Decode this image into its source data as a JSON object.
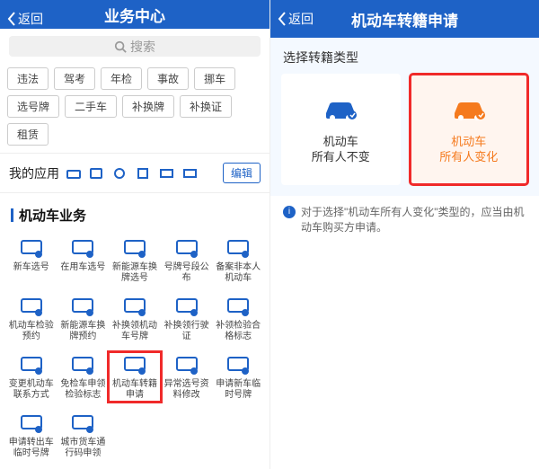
{
  "left": {
    "back": "返回",
    "title": "业务中心",
    "search_placeholder": "搜索",
    "chips": [
      "违法",
      "驾考",
      "年检",
      "事故",
      "挪车",
      "选号牌",
      "二手车",
      "补换牌",
      "补换证",
      "租赁"
    ],
    "myapps_label": "我的应用",
    "edit_label": "编辑",
    "section_title": "机动车业务",
    "grid": [
      "新车选号",
      "在用车选号",
      "新能源车换牌选号",
      "号牌号段公布",
      "备案非本人机动车",
      "机动车检验预约",
      "新能源车换牌预约",
      "补换领机动车号牌",
      "补换领行驶证",
      "补领检验合格标志",
      "变更机动车联系方式",
      "免检车申领检验标志",
      "机动车转籍申请",
      "异常选号资料修改",
      "申请新车临时号牌",
      "申请转出车临时号牌",
      "城市货车通行码申领"
    ],
    "highlight_index": 12
  },
  "right": {
    "back": "返回",
    "title": "机动车转籍申请",
    "subtitle": "选择转籍类型",
    "cards": [
      {
        "caption": "机动车\n所有人不变"
      },
      {
        "caption": "机动车\n所有人变化"
      }
    ],
    "highlight_index": 1,
    "note": "对于选择\"机动车所有人变化\"类型的，应当由机动车购买方申请。"
  }
}
